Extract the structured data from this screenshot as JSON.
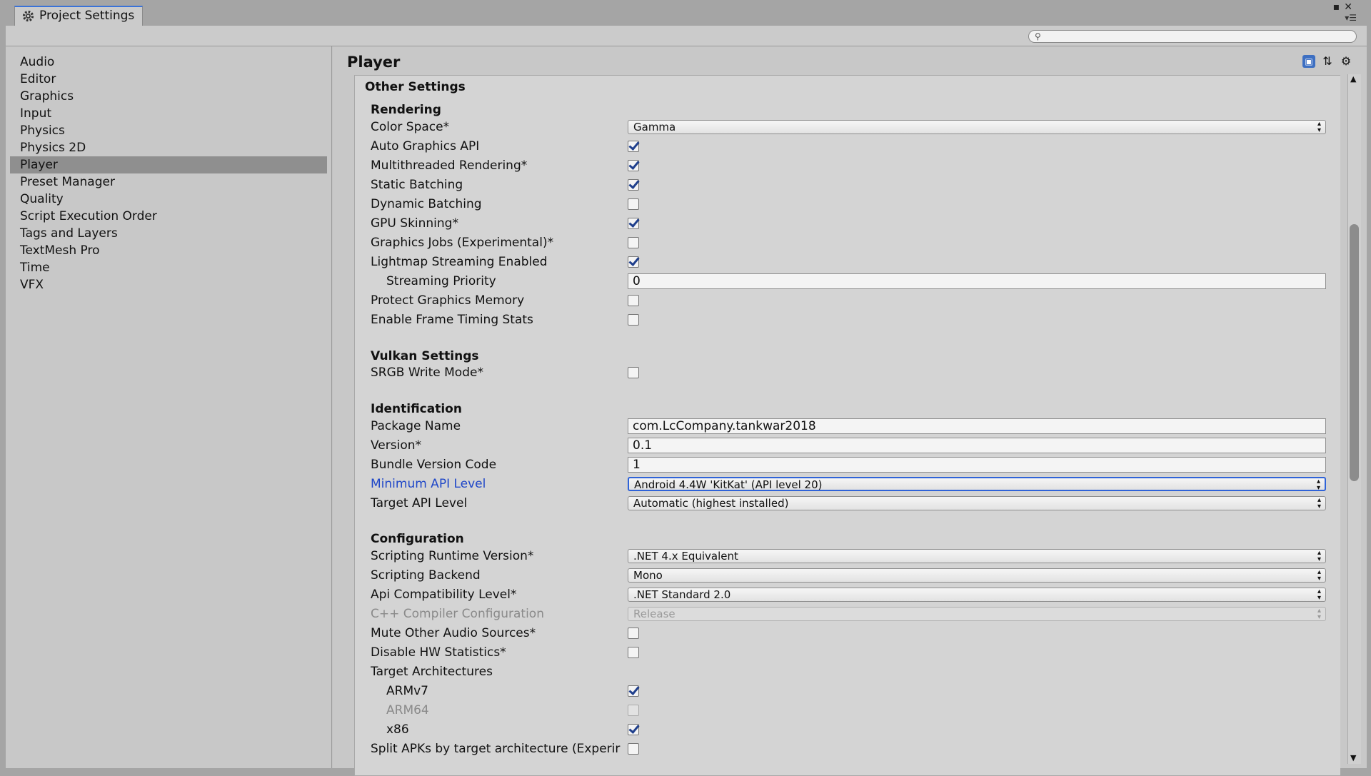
{
  "window": {
    "tab_title": "Project Settings",
    "search": {
      "placeholder": "",
      "value": ""
    }
  },
  "sidebar": {
    "items": [
      {
        "label": "Audio",
        "selected": false
      },
      {
        "label": "Editor",
        "selected": false
      },
      {
        "label": "Graphics",
        "selected": false
      },
      {
        "label": "Input",
        "selected": false
      },
      {
        "label": "Physics",
        "selected": false
      },
      {
        "label": "Physics 2D",
        "selected": false
      },
      {
        "label": "Player",
        "selected": true
      },
      {
        "label": "Preset Manager",
        "selected": false
      },
      {
        "label": "Quality",
        "selected": false
      },
      {
        "label": "Script Execution Order",
        "selected": false
      },
      {
        "label": "Tags and Layers",
        "selected": false
      },
      {
        "label": "TextMesh Pro",
        "selected": false
      },
      {
        "label": "Time",
        "selected": false
      },
      {
        "label": "VFX",
        "selected": false
      }
    ]
  },
  "main": {
    "title": "Player",
    "section_title": "Other Settings",
    "groups": {
      "rendering": "Rendering",
      "vulkan": "Vulkan Settings",
      "identification": "Identification",
      "configuration": "Configuration"
    },
    "rendering": {
      "color_space": {
        "label": "Color Space*",
        "value": "Gamma"
      },
      "auto_graphics_api": {
        "label": "Auto Graphics API",
        "checked": true
      },
      "multithreaded_rendering": {
        "label": "Multithreaded Rendering*",
        "checked": true
      },
      "static_batching": {
        "label": "Static Batching",
        "checked": true
      },
      "dynamic_batching": {
        "label": "Dynamic Batching",
        "checked": false
      },
      "gpu_skinning": {
        "label": "GPU Skinning*",
        "checked": true
      },
      "graphics_jobs": {
        "label": "Graphics Jobs (Experimental)*",
        "checked": false
      },
      "lightmap_streaming": {
        "label": "Lightmap Streaming Enabled",
        "checked": true
      },
      "streaming_priority": {
        "label": "Streaming Priority",
        "value": "0"
      },
      "protect_graphics_memory": {
        "label": "Protect Graphics Memory",
        "checked": false
      },
      "frame_timing_stats": {
        "label": "Enable Frame Timing Stats",
        "checked": false
      }
    },
    "vulkan": {
      "srgb_write_mode": {
        "label": "SRGB Write Mode*",
        "checked": false
      }
    },
    "identification": {
      "package_name": {
        "label": "Package Name",
        "value": "com.LcCompany.tankwar2018"
      },
      "version": {
        "label": "Version*",
        "value": "0.1"
      },
      "bundle_version_code": {
        "label": "Bundle Version Code",
        "value": "1"
      },
      "min_api_level": {
        "label": "Minimum API Level",
        "value": "Android 4.4W 'KitKat' (API level 20)"
      },
      "target_api_level": {
        "label": "Target API Level",
        "value": "Automatic (highest installed)"
      }
    },
    "configuration": {
      "scripting_runtime": {
        "label": "Scripting Runtime Version*",
        "value": ".NET 4.x Equivalent"
      },
      "scripting_backend": {
        "label": "Scripting Backend",
        "value": "Mono"
      },
      "api_compat": {
        "label": "Api Compatibility Level*",
        "value": ".NET Standard 2.0"
      },
      "cpp_compiler": {
        "label": "C++ Compiler Configuration",
        "value": "Release"
      },
      "mute_audio": {
        "label": "Mute Other Audio Sources*",
        "checked": false
      },
      "disable_hw_stats": {
        "label": "Disable HW Statistics*",
        "checked": false
      },
      "target_architectures": {
        "label": "Target Architectures"
      },
      "armv7": {
        "label": "ARMv7",
        "checked": true
      },
      "arm64": {
        "label": "ARM64",
        "checked": false
      },
      "x86": {
        "label": "x86",
        "checked": true
      },
      "split_apks": {
        "label": "Split APKs by target architecture (Experir",
        "checked": false
      }
    }
  }
}
